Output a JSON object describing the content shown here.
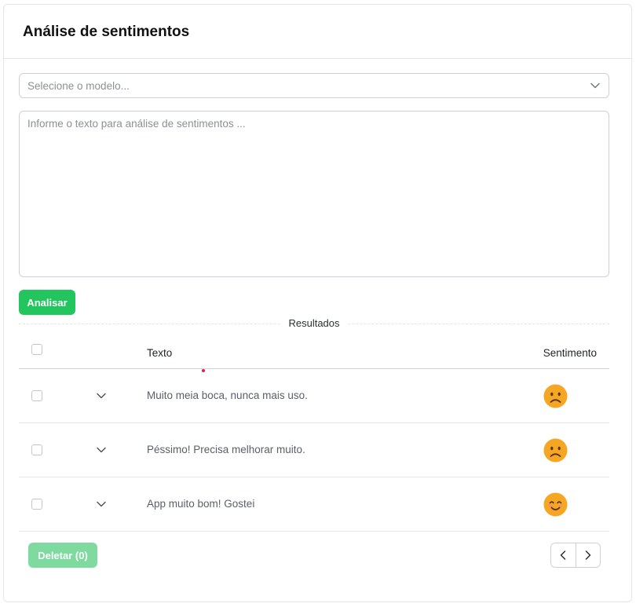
{
  "header": {
    "title": "Análise de sentimentos"
  },
  "form": {
    "model_select": {
      "placeholder": "Selecione o modelo...",
      "icon": "chevron-down-icon"
    },
    "text_input": {
      "placeholder": "Informe o texto para análise de sentimentos ..."
    },
    "analyze_button": "Analisar"
  },
  "results": {
    "divider_label": "Resultados",
    "columns": {
      "text": "Texto",
      "sentiment": "Sentimento"
    },
    "rows": [
      {
        "text": "Muito meia boca, nunca mais uso.",
        "sentiment_icon": "sad-face-icon"
      },
      {
        "text": "Péssimo! Precisa melhorar muito.",
        "sentiment_icon": "sad-face-icon"
      },
      {
        "text": "App muito bom! Gostei",
        "sentiment_icon": "happy-face-icon"
      }
    ]
  },
  "footer": {
    "delete_button": "Deletar (0)",
    "pager": {
      "prev_icon": "chevron-left-icon",
      "next_icon": "chevron-right-icon"
    }
  },
  "colors": {
    "primary": "#22c55e",
    "primary_disabled": "#7fdaa0",
    "emoji": "#f5a623"
  }
}
